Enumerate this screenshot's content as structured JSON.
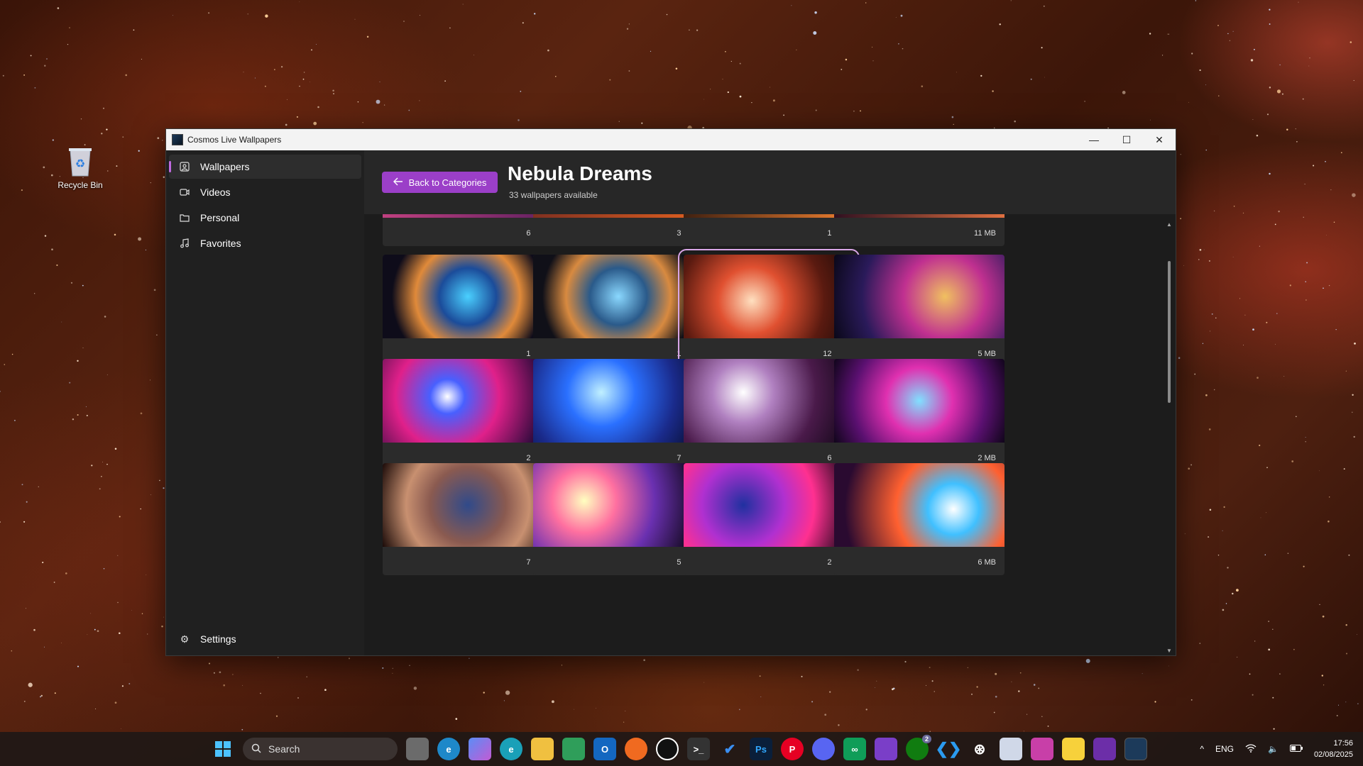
{
  "desktop": {
    "recycle_bin_label": "Recycle Bin"
  },
  "window": {
    "title": "Cosmos Live Wallpapers",
    "controls": {
      "minimize": "—",
      "maximize": "☐",
      "close": "✕"
    }
  },
  "sidebar": {
    "items": [
      {
        "label": "Wallpapers",
        "icon": "image-icon",
        "active": true
      },
      {
        "label": "Videos",
        "icon": "video-icon",
        "active": false
      },
      {
        "label": "Personal",
        "icon": "folder-icon",
        "active": false
      },
      {
        "label": "Favorites",
        "icon": "music-note-icon",
        "active": false
      }
    ],
    "settings_label": "Settings"
  },
  "header": {
    "back_label": "Back to Categories",
    "title": "Nebula Dreams",
    "subtitle": "33 wallpapers available"
  },
  "grid": {
    "partial_row": [
      "6 MB",
      "3 MB",
      "1 MB",
      "11 MB"
    ],
    "rows": [
      [
        "1 MB",
        "1 MB",
        "12 MB",
        "5 MB"
      ],
      [
        "2 MB",
        "7 MB",
        "6 MB",
        "2 MB"
      ],
      [
        "7 MB",
        "5 MB",
        "2 MB",
        "6 MB"
      ]
    ],
    "selected_row": 0,
    "selected_col": 2
  },
  "taskbar": {
    "search_placeholder": "Search",
    "language": "ENG",
    "time": "17:56",
    "date": "02/08/2025",
    "xbox_badge": "2"
  },
  "colors": {
    "accent": "#9b3fc8",
    "window_bg": "#202020",
    "header_bg": "#272727"
  }
}
